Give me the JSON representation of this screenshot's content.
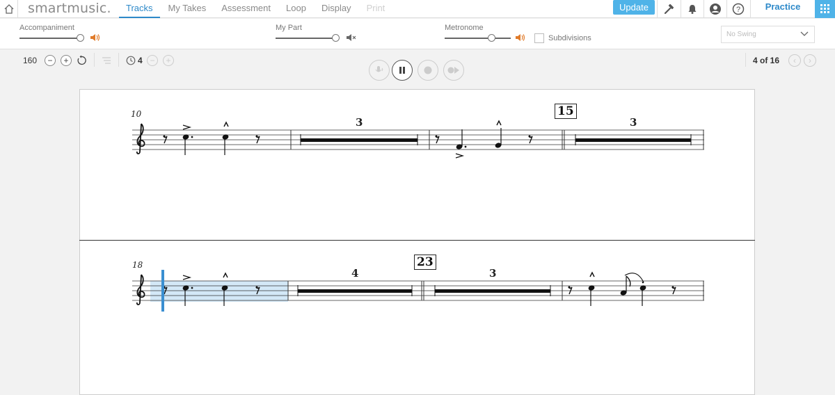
{
  "app": {
    "logo": "smartmusic."
  },
  "nav": {
    "tabs": [
      {
        "label": "Tracks",
        "state": "active"
      },
      {
        "label": "My Takes",
        "state": "normal"
      },
      {
        "label": "Assessment",
        "state": "normal"
      },
      {
        "label": "Loop",
        "state": "normal"
      },
      {
        "label": "Display",
        "state": "normal"
      },
      {
        "label": "Print",
        "state": "disabled"
      }
    ],
    "update_label": "Update",
    "practice_label": "Practice",
    "icons": [
      "tuner-fork-icon",
      "bell-icon",
      "account-icon",
      "help-icon",
      "apps-grid-icon"
    ]
  },
  "mixer": {
    "accompaniment_label": "Accompaniment",
    "accompaniment_level": 1.0,
    "my_part_label": "My Part",
    "my_part_level": 1.0,
    "my_part_muted": true,
    "metronome_label": "Metronome",
    "metronome_level": 0.72,
    "subdivisions_label": "Subdivisions",
    "subdivisions_checked": false,
    "swing_placeholder": "No Swing"
  },
  "transport": {
    "tempo": "160",
    "countoff": "4",
    "page_indicator": "4 of 16",
    "state": "playing"
  },
  "score": {
    "systems": [
      {
        "start_measure": "10",
        "rehearsal": "15",
        "multirests": [
          "3",
          "3"
        ]
      },
      {
        "start_measure": "18",
        "rehearsal": "23",
        "multirests": [
          "4",
          "3"
        ]
      }
    ]
  },
  "colors": {
    "accent": "#2d89c9",
    "update_bg": "#4fb3e8",
    "speaker": "#e07b2a",
    "selection": "#d3e8f7",
    "cursor": "#3a8fd1"
  }
}
